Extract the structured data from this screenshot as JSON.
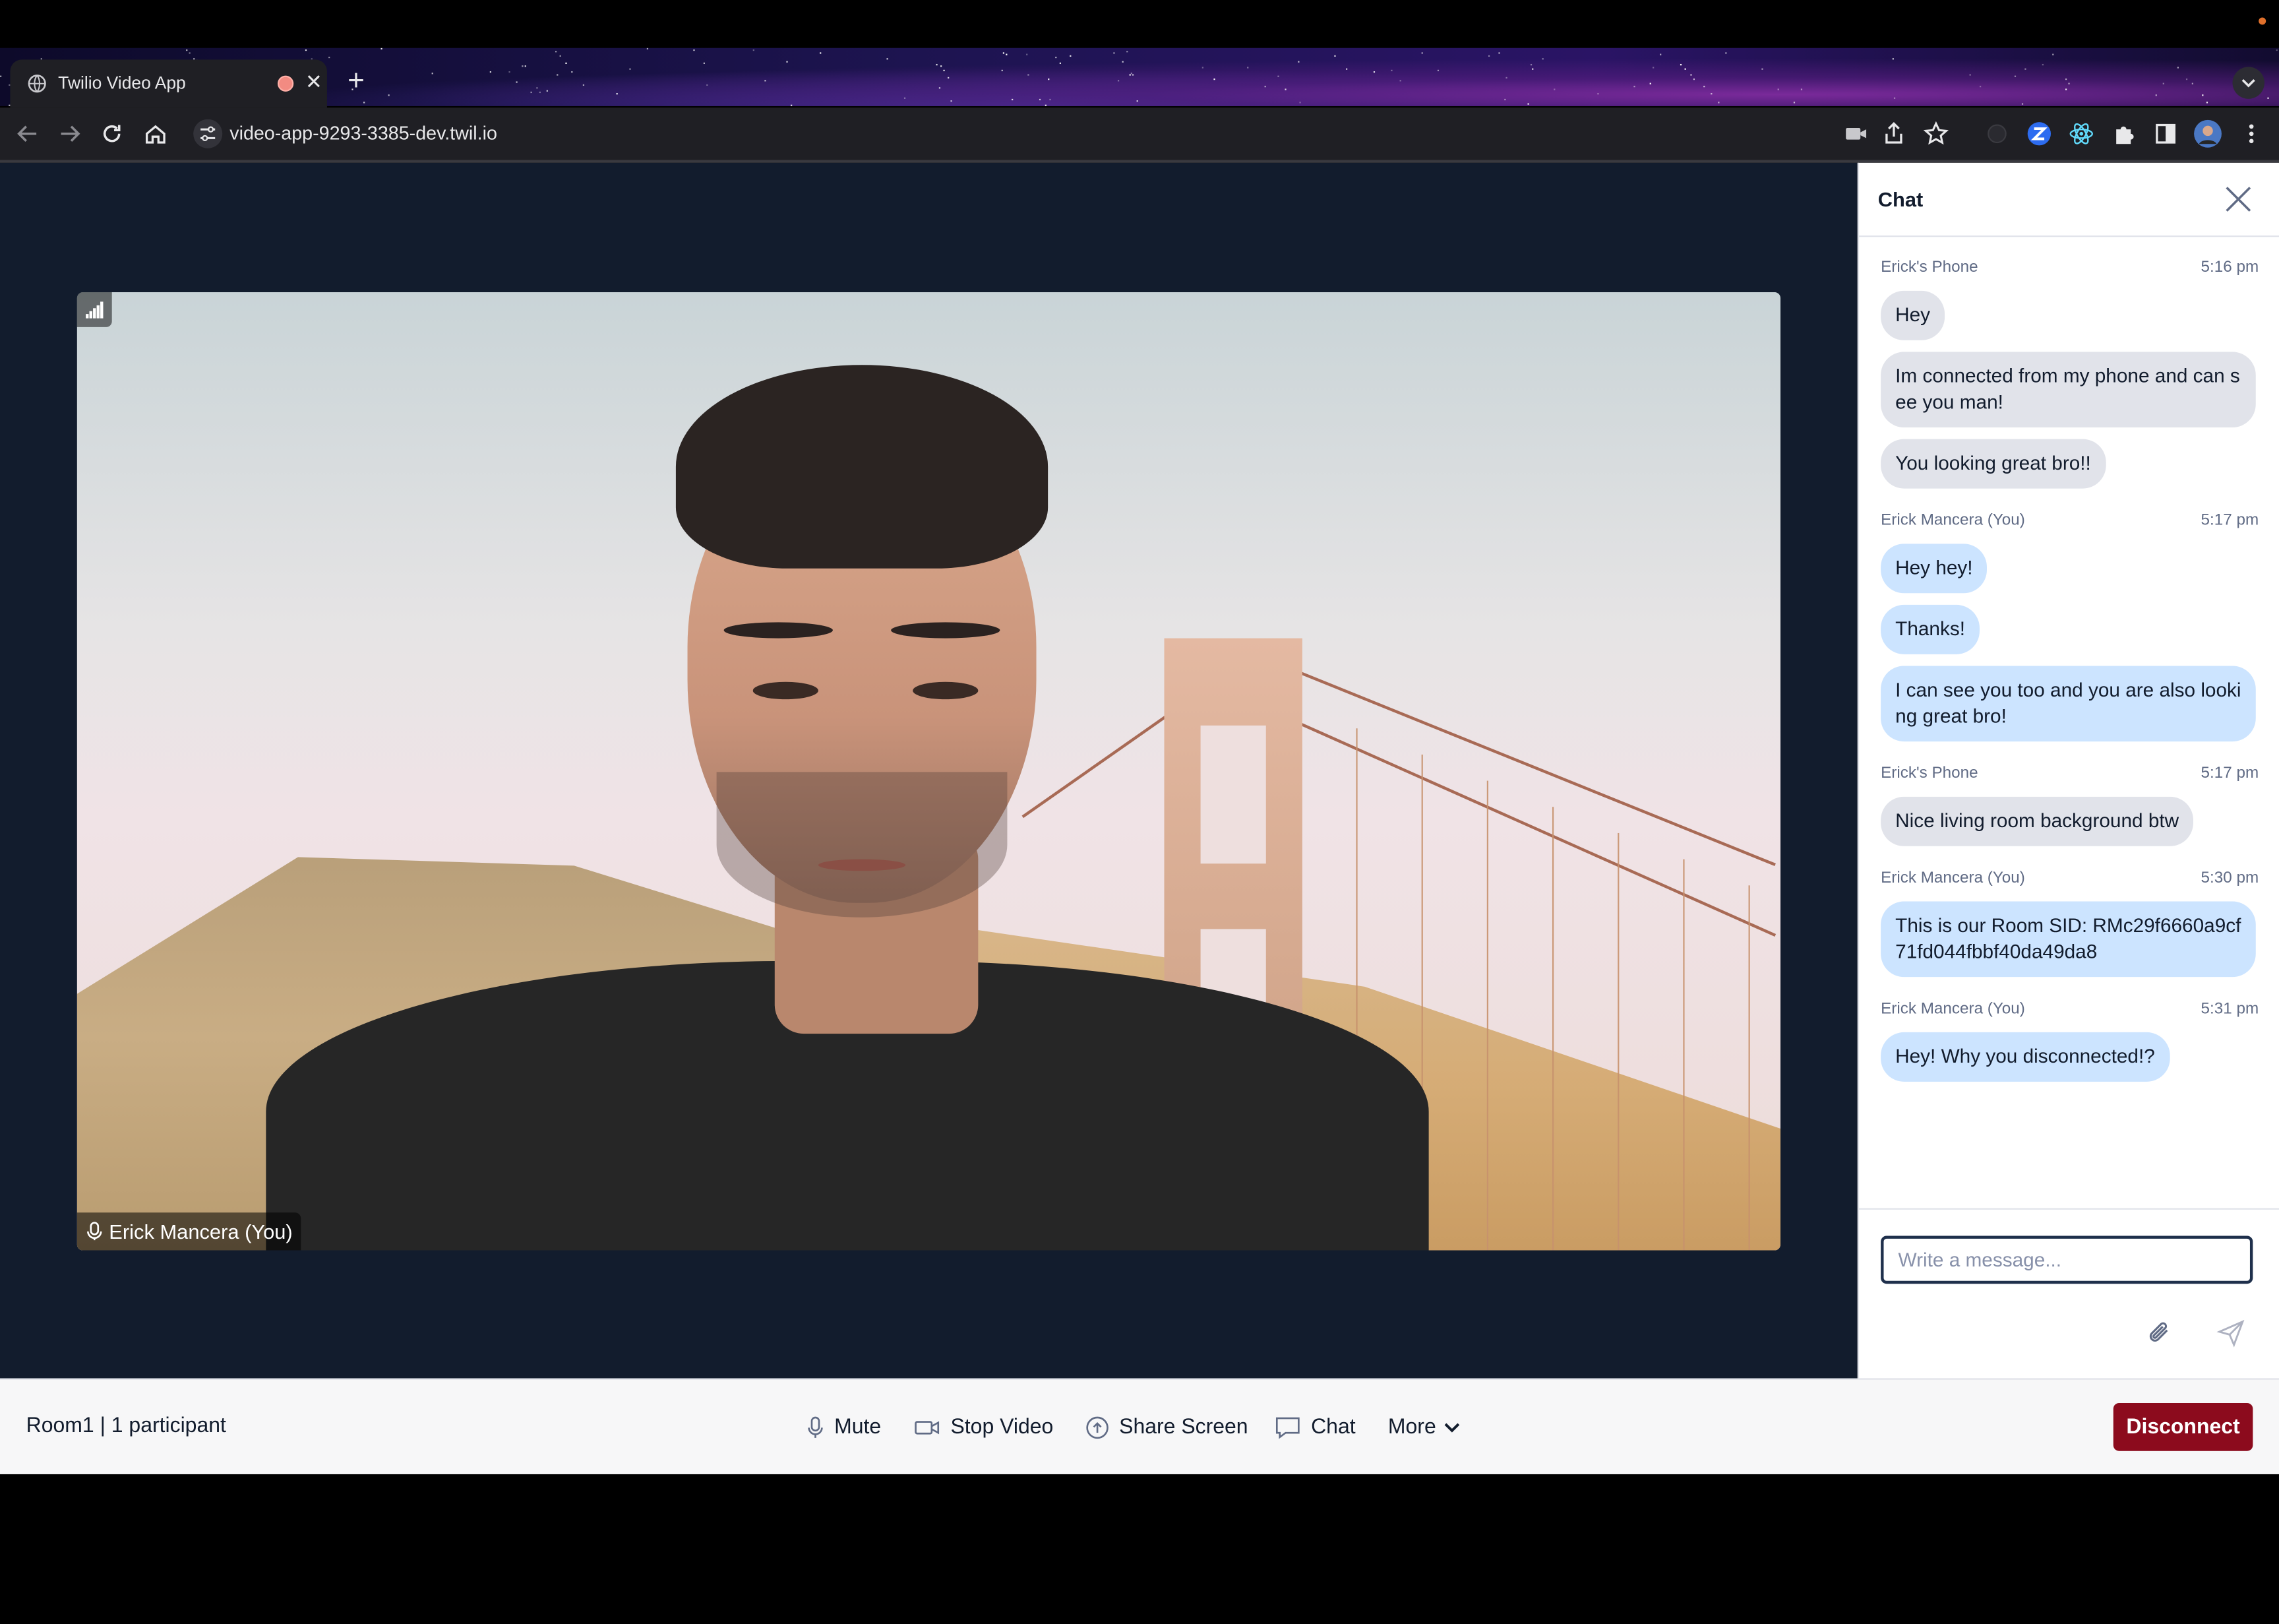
{
  "browser": {
    "tab_title": "Twilio Video App",
    "url": "video-app-9293-3385-dev.twil.io",
    "tab_close": "✕",
    "new_tab": "+"
  },
  "video": {
    "participant_label": "Erick Mancera (You)"
  },
  "chat": {
    "title": "Chat",
    "groups": [
      {
        "author": "Erick's Phone",
        "time": "5:16 pm",
        "side": "them",
        "messages": [
          "Hey",
          "Im connected from my phone and can see you man!",
          "You looking great bro!!"
        ]
      },
      {
        "author": "Erick Mancera (You)",
        "time": "5:17 pm",
        "side": "you",
        "messages": [
          "Hey hey!",
          "Thanks!",
          "I can see you too and you are also looking great bro!"
        ]
      },
      {
        "author": "Erick's Phone",
        "time": "5:17 pm",
        "side": "them",
        "messages": [
          "Nice living room background btw"
        ]
      },
      {
        "author": "Erick Mancera (You)",
        "time": "5:30 pm",
        "side": "you",
        "messages": [
          "This is our Room SID: RMc29f6660a9cf71fd044fbbf40da49da8"
        ]
      },
      {
        "author": "Erick Mancera (You)",
        "time": "5:31 pm",
        "side": "you",
        "messages": [
          "Hey! Why you disconnected!?"
        ]
      }
    ],
    "input_placeholder": "Write a message..."
  },
  "bottom_bar": {
    "room_info": "Room1 | 1 participant",
    "mute_label": "Mute",
    "stop_video_label": "Stop Video",
    "share_screen_label": "Share Screen",
    "chat_label": "Chat",
    "more_label": "More",
    "disconnect_label": "Disconnect"
  },
  "colors": {
    "stage_bg": "#121c2d",
    "bubble_them": "#e1e3ea",
    "bubble_you": "#cce4ff",
    "disconnect_bg": "#8c0b1d"
  }
}
